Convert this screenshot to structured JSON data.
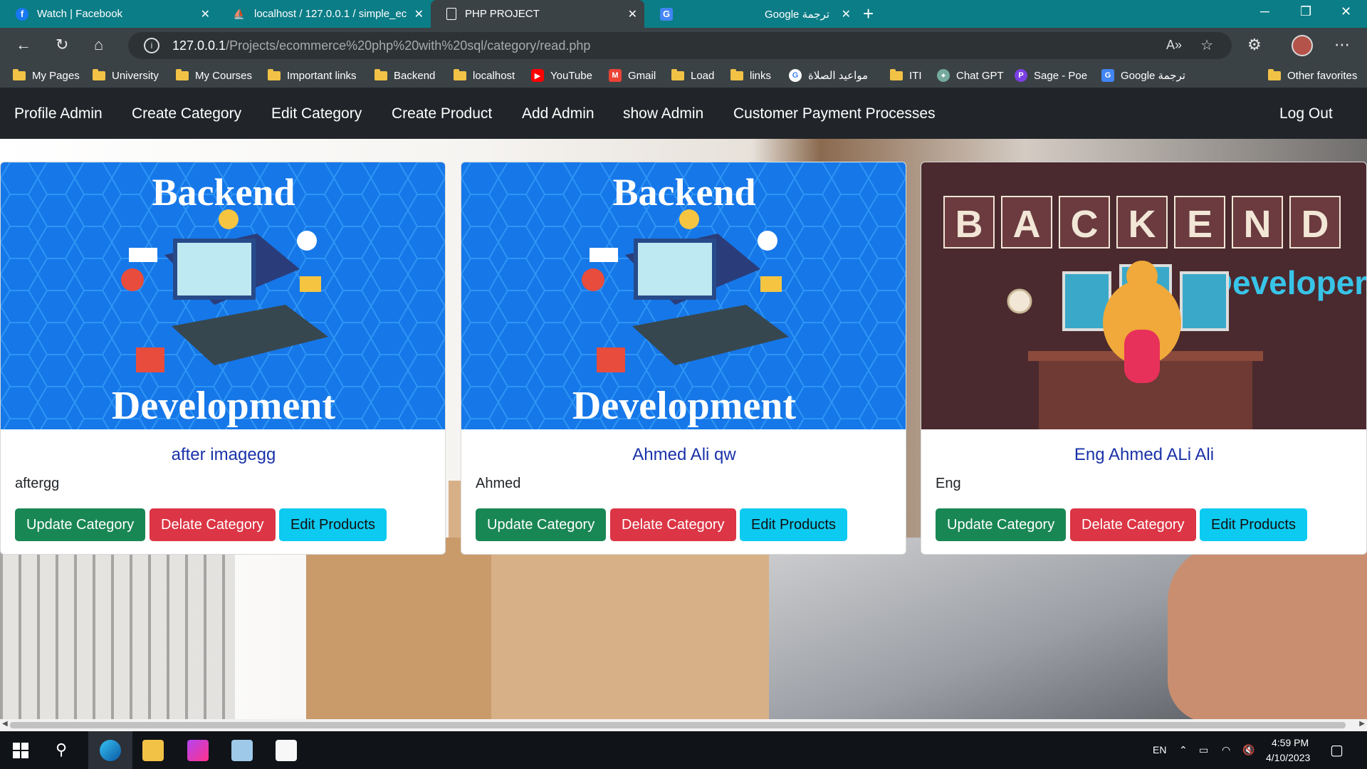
{
  "browser": {
    "tabs": [
      {
        "title": "Watch | Facebook",
        "icon": "facebook-icon"
      },
      {
        "title": "localhost / 127.0.0.1 / simple_ec",
        "icon": "phpmyadmin-icon"
      },
      {
        "title": "PHP PROJECT",
        "icon": "page-icon"
      },
      {
        "title": "Google ترجمة",
        "icon": "google-translate-icon"
      }
    ],
    "url_host": "127.0.0.1",
    "url_path": "/Projects/ecommerce%20php%20with%20sql/category/read.php",
    "favorites": [
      {
        "label": "My Pages",
        "icon": "folder-icon"
      },
      {
        "label": "University",
        "icon": "folder-icon"
      },
      {
        "label": "My Courses",
        "icon": "folder-icon"
      },
      {
        "label": "Important links",
        "icon": "folder-icon"
      },
      {
        "label": "Backend",
        "icon": "folder-icon"
      },
      {
        "label": "localhost",
        "icon": "folder-icon"
      },
      {
        "label": "YouTube",
        "icon": "youtube-icon"
      },
      {
        "label": "Gmail",
        "icon": "gmail-icon"
      },
      {
        "label": "Load",
        "icon": "folder-icon"
      },
      {
        "label": "links",
        "icon": "folder-icon"
      },
      {
        "label": "مواعيد الصلاة",
        "icon": "google-icon"
      },
      {
        "label": "ITI",
        "icon": "folder-icon"
      },
      {
        "label": "Chat GPT",
        "icon": "chatgpt-icon"
      },
      {
        "label": "Sage - Poe",
        "icon": "poe-icon"
      },
      {
        "label": "Google ترجمة",
        "icon": "google-translate-icon"
      },
      {
        "label": "Other favorites",
        "icon": "folder-icon"
      }
    ]
  },
  "site_nav": {
    "links": [
      "Profile Admin",
      "Create Category",
      "Edit Category",
      "Create Product",
      "Add Admin",
      "show Admin",
      "Customer Payment Processes"
    ],
    "logout": "Log Out"
  },
  "cards": [
    {
      "image_heading": "Backend",
      "image_footer": "Development",
      "title": "after imagegg",
      "text": "aftergg",
      "update_label": "Update Category",
      "delete_label": "Delate Category",
      "edit_label": "Edit Products"
    },
    {
      "image_heading": "Backend",
      "image_footer": "Development",
      "title": "Ahmed Ali qw",
      "text": "Ahmed",
      "update_label": "Update Category",
      "delete_label": "Delate Category",
      "edit_label": "Edit Products"
    },
    {
      "image_letters": [
        "B",
        "A",
        "C",
        "K",
        "E",
        "N",
        "D"
      ],
      "image_caption": "Developer",
      "title": "Eng Ahmed ALi Ali",
      "text": "Eng",
      "update_label": "Update Category",
      "delete_label": "Delate Category",
      "edit_label": "Edit Products"
    }
  ],
  "taskbar": {
    "lang": "EN",
    "time": "4:59 PM",
    "date": "4/10/2023"
  },
  "colors": {
    "tabstrip": "#0b7d87",
    "browser_chrome": "#3b4245",
    "navbar": "#212529",
    "btn_update": "#198754",
    "btn_delete": "#dc3545",
    "btn_edit": "#0dcaf0",
    "card_title": "#1a32a8"
  }
}
